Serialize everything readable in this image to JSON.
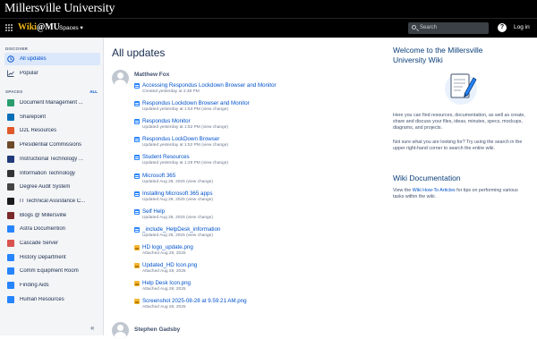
{
  "brand": {
    "title": "Millersville University"
  },
  "nav": {
    "logo_wiki": "Wiki",
    "logo_mu": "@MU",
    "spaces_label": "Spaces",
    "search_placeholder": "Search",
    "help": "?",
    "login": "Log in"
  },
  "sidebar": {
    "discover_header": "DISCOVER",
    "discover_items": [
      {
        "label": "All updates",
        "icon": "clock-icon",
        "active": true
      },
      {
        "label": "Popular",
        "icon": "chart-icon",
        "active": false
      }
    ],
    "spaces_header": "SPACES",
    "spaces_all": "ALL",
    "spaces": [
      {
        "label": "Document Management ...",
        "color": "#2a9d6f"
      },
      {
        "label": "Sharepoint",
        "color": "#0b6fb8"
      },
      {
        "label": "D2L Resources",
        "color": "#e0592a"
      },
      {
        "label": "Presidential Commissions",
        "color": "#6e4b2a"
      },
      {
        "label": "Instructional Technology ...",
        "color": "#1f3a7a"
      },
      {
        "label": "Information Technology",
        "color": "#333333"
      },
      {
        "label": "Degree Audit System",
        "color": "#444444"
      },
      {
        "label": "IT Technical Assistance C...",
        "color": "#1b1b1b"
      },
      {
        "label": "Blogs @ Millersville",
        "color": "#7a2a2a"
      },
      {
        "label": "Astra Documention",
        "color": "#2684ff"
      },
      {
        "label": "Cascade Server",
        "color": "#d9534f"
      },
      {
        "label": "History Department",
        "color": "#2684ff"
      },
      {
        "label": "Comm Equipment Room",
        "color": "#2684ff"
      },
      {
        "label": "Finding Aids",
        "color": "#2684ff"
      },
      {
        "label": "Human Resources",
        "color": "#2684ff"
      }
    ],
    "collapse": "«"
  },
  "main": {
    "title": "All updates",
    "groups": [
      {
        "user": "Matthew Fox",
        "updates": [
          {
            "title": "Accessing Respondus Lockdown Browser and Monitor",
            "meta": "Created yesterday at 2:38 PM",
            "type": "page"
          },
          {
            "title": "Respondus Lockdown Browser and Monitor",
            "meta": "Updated yesterday at 1:53 PM (view change)",
            "type": "page"
          },
          {
            "title": "Respondus Monitor",
            "meta": "Updated yesterday at 1:52 PM (view change)",
            "type": "page"
          },
          {
            "title": "Respondus LockDown Browser",
            "meta": "Updated yesterday at 1:52 PM (view change)",
            "type": "page"
          },
          {
            "title": "Student Resources",
            "meta": "Updated yesterday at 1:28 PM (view change)",
            "type": "page"
          },
          {
            "title": "Microsoft 365",
            "meta": "Updated Aug 28, 2025 (view change)",
            "type": "page"
          },
          {
            "title": "Installing Microsoft 365 apps",
            "meta": "Updated Aug 28, 2025 (view change)",
            "type": "page"
          },
          {
            "title": "Self Help",
            "meta": "Updated Aug 28, 2025 (view change)",
            "type": "page"
          },
          {
            "title": "_include_HelpDesk_information",
            "meta": "Updated Aug 28, 2025 (view change)",
            "type": "page"
          },
          {
            "title": "HD logo_update.png",
            "meta": "Attached Aug 28, 2025",
            "type": "img"
          },
          {
            "title": "Updated_HD Icon.png",
            "meta": "Attached Aug 28, 2025",
            "type": "img"
          },
          {
            "title": "Help Desk Icon.png",
            "meta": "Attached Aug 28, 2025",
            "type": "img"
          },
          {
            "title": "Screenshot 2025-08-28 at 9.59.21 AM.png",
            "meta": "Attached Aug 28, 2025",
            "type": "img"
          }
        ]
      },
      {
        "user": "Stephen Gadsby",
        "updates": []
      }
    ]
  },
  "right": {
    "welcome_title_1": "Welcome to the Millersville",
    "welcome_title_2": "University Wiki",
    "welcome_text": "Here you can find resources, documentation, as well as create, share and discuss your files, ideas, minutes, specs, mockups, diagrams, and projects.",
    "not_sure_text": "Not sure what you are looking for? Try using the search in the upper right-hand corner to search the entire wiki.",
    "doc_title": "Wiki Documentation",
    "doc_text_pre": "View the ",
    "doc_link": "Wiki How-To Articles",
    "doc_text_post": " for tips on performing various tasks within the wiki."
  }
}
